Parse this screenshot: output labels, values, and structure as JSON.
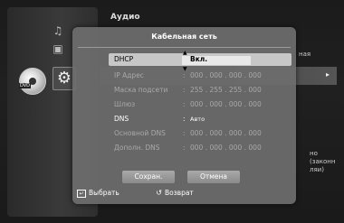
{
  "background": {
    "menu_header": "Аудио",
    "right_label_1": "ная",
    "right_label_2_line1": "но (законн",
    "right_label_2_line2": "ляи)"
  },
  "dialog": {
    "title": "Кабельная сеть",
    "rows": [
      {
        "label": "DHCP",
        "value": "Вкл.",
        "state": "selected"
      },
      {
        "label": "IP Адрес",
        "value": "000 . 000 . 000 . 000",
        "state": "disabled"
      },
      {
        "label": "Маска подсети",
        "value": "255 . 255 . 255 . 000",
        "state": "disabled"
      },
      {
        "label": "Шлюз",
        "value": "000 . 000 . 000 . 000",
        "state": "disabled"
      },
      {
        "label": "DNS",
        "value": "Авто",
        "state": "enabled"
      },
      {
        "label": "Основной DNS",
        "value": "000 . 000 . 000 . 000",
        "state": "disabled"
      },
      {
        "label": "Дополн. DNS",
        "value": "000 . 000 . 000 . 000",
        "state": "disabled"
      }
    ],
    "save_label": "Сохран.",
    "cancel_label": "Отмена",
    "colon": ":"
  },
  "footer": {
    "select_label": "Выбрать",
    "return_label": "Возврат"
  },
  "icons": {
    "side_top": "music-note-icon",
    "side_mid": "photo-icon",
    "disc": "dvd-disc-icon",
    "settings": "gear-icon"
  }
}
